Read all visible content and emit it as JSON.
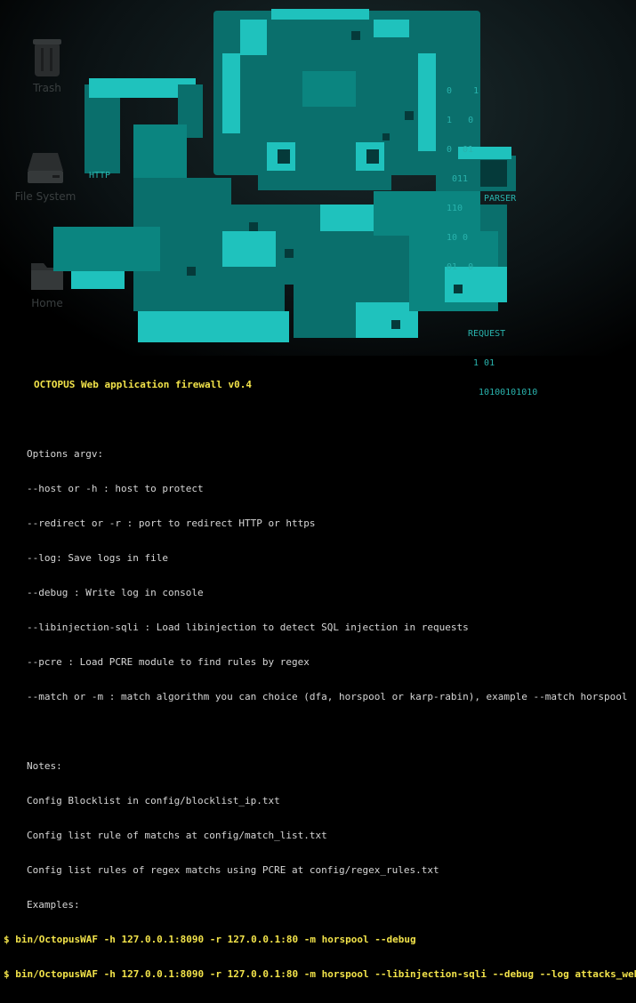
{
  "desktop": {
    "icons": [
      {
        "label": "Trash",
        "icon": "trash-icon"
      },
      {
        "label": "File System",
        "icon": "drive-icon"
      },
      {
        "label": "Home",
        "icon": "folder-icon"
      }
    ]
  },
  "art": {
    "binary_lines": [
      "0    1",
      "1   0",
      "0  01",
      " 011",
      "110",
      "10 0",
      "01  0"
    ],
    "http_label": "HTTP",
    "parser_label": "PARSER",
    "request_lines": [
      "REQUEST",
      " 1 01",
      "  10100101010"
    ],
    "colors": {
      "body": "#0a6f6c",
      "highlight": "#1fc2bd",
      "dark": "#053a3a"
    }
  },
  "terminal": {
    "title": "OCTOPUS Web application firewall v0.4",
    "lines": [
      "",
      "Options argv:",
      "--host or -h : host to protect",
      "--redirect or -r : port to redirect HTTP or https",
      "--log: Save logs in file",
      "--debug : Write log in console",
      "--libinjection-sqli : Load libinjection to detect SQL injection in requests",
      "--pcre : Load PCRE module to find rules by regex",
      "--match or -m : match algorithm you can choice (dfa, horspool or karp-rabin), example --match horspool",
      "",
      "Notes:",
      "Config Blocklist in config/blocklist_ip.txt",
      "Config list rule of matchs at config/match_list.txt",
      "Config list rules of regex matchs using PCRE at config/regex_rules.txt",
      "Examples:"
    ],
    "commands": [
      "$ bin/OctopusWAF -h 127.0.0.1:8090 -r 127.0.0.1:80 -m horspool --debug",
      "$ bin/OctopusWAF -h 127.0.0.1:8090 -r 127.0.0.1:80 -m horspool --libinjection-sqli --debug --log attacks_web.txt"
    ]
  }
}
